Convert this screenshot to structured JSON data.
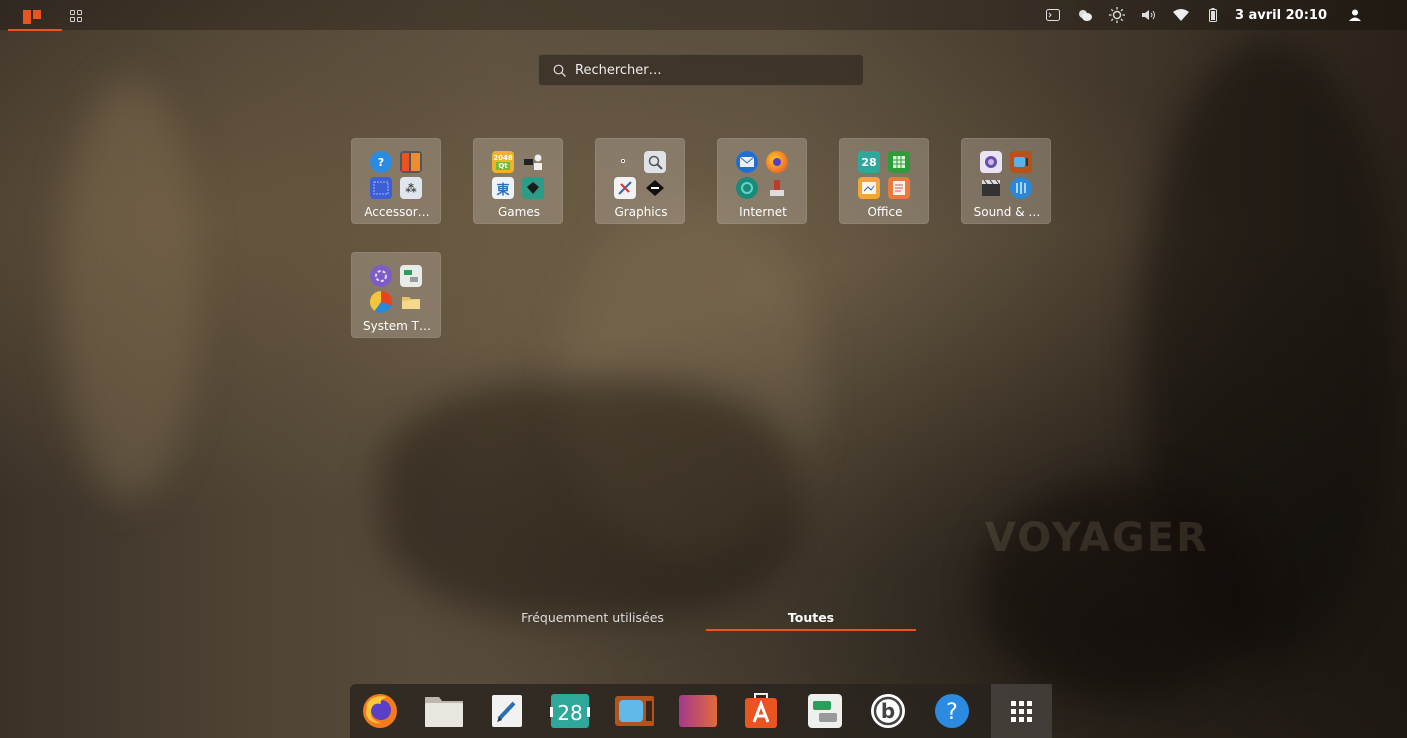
{
  "topbar": {
    "activities_icon": "ubuntu-activities-icon",
    "apps_icon": "app-grid-icon",
    "tray_icons": [
      "terminal-icon",
      "weather-icon",
      "brightness-icon",
      "volume-icon",
      "wifi-icon",
      "battery-icon"
    ],
    "clock": "3 avril 20:10",
    "user_icon": "user-icon"
  },
  "search": {
    "placeholder": "Rechercher…"
  },
  "folders": [
    {
      "label": "Accessor…",
      "icons": [
        "help-icon",
        "calculator-icon",
        "screenshot-icon",
        "character-map-icon"
      ]
    },
    {
      "label": "Games",
      "icons": [
        "2048-icon",
        "chess-icon",
        "mahjongg-icon",
        "mines-icon"
      ]
    },
    {
      "label": "Graphics",
      "icons": [
        "gimp-icon",
        "image-viewer-icon",
        "draw-icon",
        "inkscape-icon"
      ]
    },
    {
      "label": "Internet",
      "icons": [
        "thunderbird-icon",
        "firefox-icon",
        "remote-desktop-icon",
        "transmission-icon"
      ]
    },
    {
      "label": "Office",
      "icons": [
        "calendar-icon",
        "spreadsheet-icon",
        "impress-icon",
        "document-icon"
      ]
    },
    {
      "label": "Sound & …",
      "icons": [
        "audio-recorder-icon",
        "tv-icon",
        "video-editor-icon",
        "music-icon"
      ]
    },
    {
      "label": "System T…",
      "icons": [
        "settings-icon",
        "tweaks-icon",
        "disk-usage-icon",
        "files-icon"
      ]
    }
  ],
  "tabs": {
    "frequent": "Fréquemment utilisées",
    "all": "Toutes"
  },
  "dock": {
    "items": [
      {
        "name": "firefox-icon"
      },
      {
        "name": "files-icon"
      },
      {
        "name": "text-editor-icon"
      },
      {
        "name": "calendar-icon",
        "text": "28"
      },
      {
        "name": "tv-icon"
      },
      {
        "name": "video-editor-icon"
      },
      {
        "name": "software-center-icon"
      },
      {
        "name": "tweaks-icon"
      },
      {
        "name": "boot-repair-icon"
      },
      {
        "name": "help-icon",
        "text": "?"
      },
      {
        "name": "show-applications-icon"
      }
    ]
  },
  "colors": {
    "accent": "#e95420",
    "folder_bg": "#c8bead",
    "dock_bg": "#28231e"
  },
  "watermark": "VOYAGER"
}
